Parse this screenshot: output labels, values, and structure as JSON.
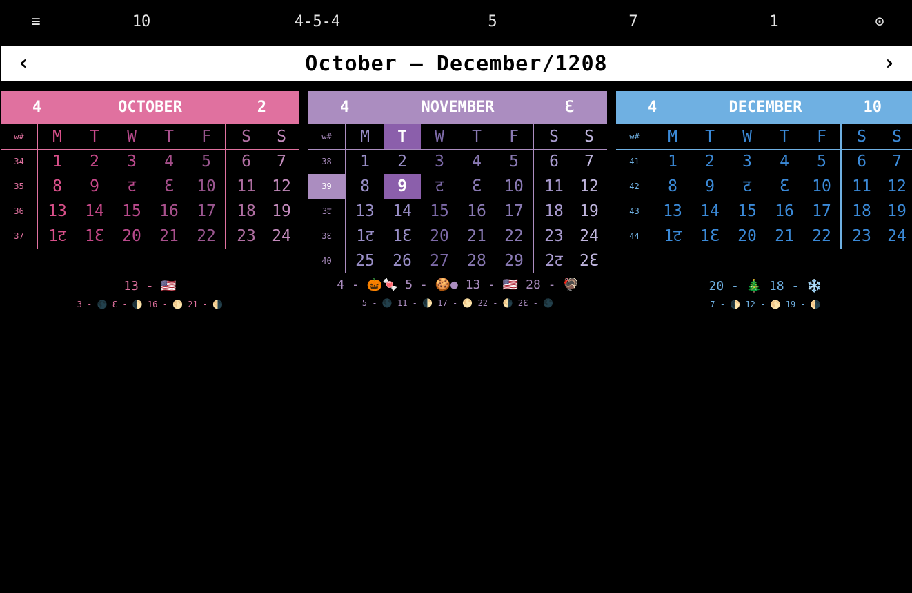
{
  "topbar": {
    "menu_icon": "≡",
    "days_left": "10",
    "pattern": "4-5-4",
    "w5": "5",
    "w7": "7",
    "w1": "1",
    "target_icon": "⊙"
  },
  "title": {
    "prev": "‹",
    "text": "October — December/1208",
    "next": "›"
  },
  "colors": {
    "oct": "#e0719f",
    "nov": "#ab8dc0",
    "dec": "#6fb0e2"
  },
  "months": [
    {
      "name": "OCTOBER",
      "quarter": "4",
      "count": "2",
      "weekday_labels": [
        "M",
        "T",
        "W",
        "T",
        "F",
        "S",
        "S"
      ],
      "wk_header": "w#",
      "weeks": [
        {
          "wk": "34",
          "days": [
            "1",
            "2",
            "3",
            "4",
            "5",
            "6",
            "7"
          ]
        },
        {
          "wk": "35",
          "days": [
            "8",
            "9",
            "ट",
            "ℇ",
            "10",
            "11",
            "12"
          ]
        },
        {
          "wk": "36",
          "days": [
            "13",
            "14",
            "15",
            "16",
            "17",
            "18",
            "19"
          ]
        },
        {
          "wk": "37",
          "days": [
            "1ट",
            "1ℇ",
            "20",
            "21",
            "22",
            "23",
            "24"
          ]
        }
      ],
      "foot1": "13 - 🇺🇸",
      "foot2": "3 - 🌑 ℇ - 🌓 16 - 🌕 21 - 🌗"
    },
    {
      "name": "NOVEMBER",
      "quarter": "4",
      "count": "ℇ",
      "weekday_labels": [
        "M",
        "T",
        "W",
        "T",
        "F",
        "S",
        "S"
      ],
      "wk_header": "w#",
      "weeks": [
        {
          "wk": "38",
          "days": [
            "1",
            "2",
            "3",
            "4",
            "5",
            "6",
            "7"
          ]
        },
        {
          "wk": "39",
          "days": [
            "8",
            "9",
            "ट",
            "ℇ",
            "10",
            "11",
            "12"
          ]
        },
        {
          "wk": "3ट",
          "days": [
            "13",
            "14",
            "15",
            "16",
            "17",
            "18",
            "19"
          ]
        },
        {
          "wk": "3ℇ",
          "days": [
            "1ट",
            "1ℇ",
            "20",
            "21",
            "22",
            "23",
            "24"
          ]
        },
        {
          "wk": "40",
          "days": [
            "25",
            "26",
            "27",
            "28",
            "29",
            "2ट",
            "2ℇ"
          ]
        }
      ],
      "foot1": "4 - 🎃🍬 5 - 🍪● 13 - 🇺🇸 28 - 🦃",
      "foot2": "5 - 🌑 11 - 🌓 17 - 🌕 22 - 🌗 2ℇ - 🌑"
    },
    {
      "name": "DECEMBER",
      "quarter": "4",
      "count": "10",
      "weekday_labels": [
        "M",
        "T",
        "W",
        "T",
        "F",
        "S",
        "S"
      ],
      "wk_header": "w#",
      "weeks": [
        {
          "wk": "41",
          "days": [
            "1",
            "2",
            "3",
            "4",
            "5",
            "6",
            "7"
          ]
        },
        {
          "wk": "42",
          "days": [
            "8",
            "9",
            "ट",
            "ℇ",
            "10",
            "11",
            "12"
          ]
        },
        {
          "wk": "43",
          "days": [
            "13",
            "14",
            "15",
            "16",
            "17",
            "18",
            "19"
          ]
        },
        {
          "wk": "44",
          "days": [
            "1ट",
            "1ℇ",
            "20",
            "21",
            "22",
            "23",
            "24"
          ]
        }
      ],
      "foot1": "20 - 🎄 18 - ❄️",
      "foot2": "7 - 🌓 12 - 🌕 19 - 🌗"
    }
  ]
}
